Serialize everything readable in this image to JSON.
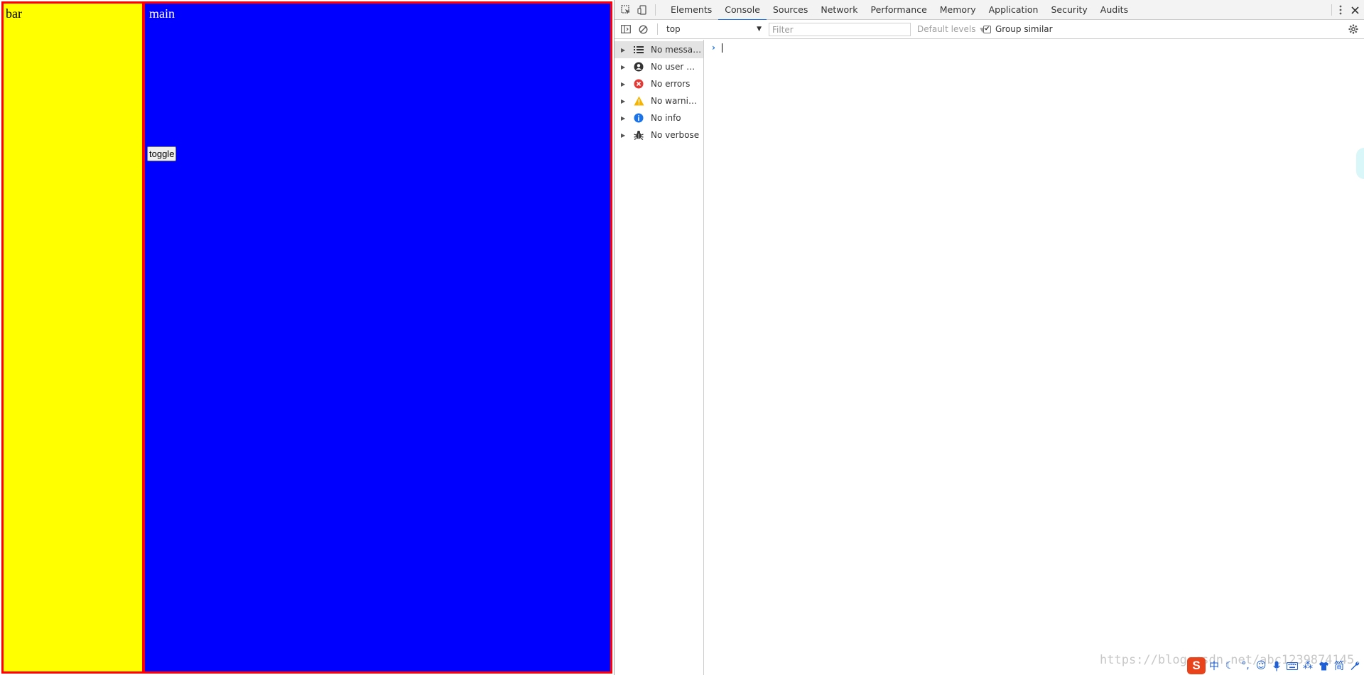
{
  "page": {
    "bar_label": "bar",
    "main_label": "main",
    "toggle_label": "toggle",
    "colors": {
      "frame_border": "#ff0000",
      "bar_background": "#ffff00",
      "main_background": "#0000ff"
    }
  },
  "devtools": {
    "tabs": [
      {
        "label": "Elements"
      },
      {
        "label": "Console"
      },
      {
        "label": "Sources"
      },
      {
        "label": "Network"
      },
      {
        "label": "Performance"
      },
      {
        "label": "Memory"
      },
      {
        "label": "Application"
      },
      {
        "label": "Security"
      },
      {
        "label": "Audits"
      }
    ],
    "active_tab": "Console",
    "toolbar": {
      "context": "top",
      "filter_placeholder": "Filter",
      "levels": "Default levels",
      "group_similar_label": "Group similar",
      "group_similar_checked": true
    },
    "sidebar": [
      {
        "label": "No messages",
        "icon": "list-icon",
        "selected": true
      },
      {
        "label": "No user me...",
        "icon": "user-icon",
        "selected": false
      },
      {
        "label": "No errors",
        "icon": "error-icon",
        "selected": false
      },
      {
        "label": "No warnings",
        "icon": "warning-icon",
        "selected": false
      },
      {
        "label": "No info",
        "icon": "info-icon",
        "selected": false
      },
      {
        "label": "No verbose",
        "icon": "bug-icon",
        "selected": false
      }
    ],
    "prompt_symbol": "›"
  },
  "overlay": {
    "watermark": "https://blog.csdn.net/abc1239874145",
    "ime_logo": "S",
    "ime_chinese_label": "中",
    "ime_simplified_label": "简"
  }
}
